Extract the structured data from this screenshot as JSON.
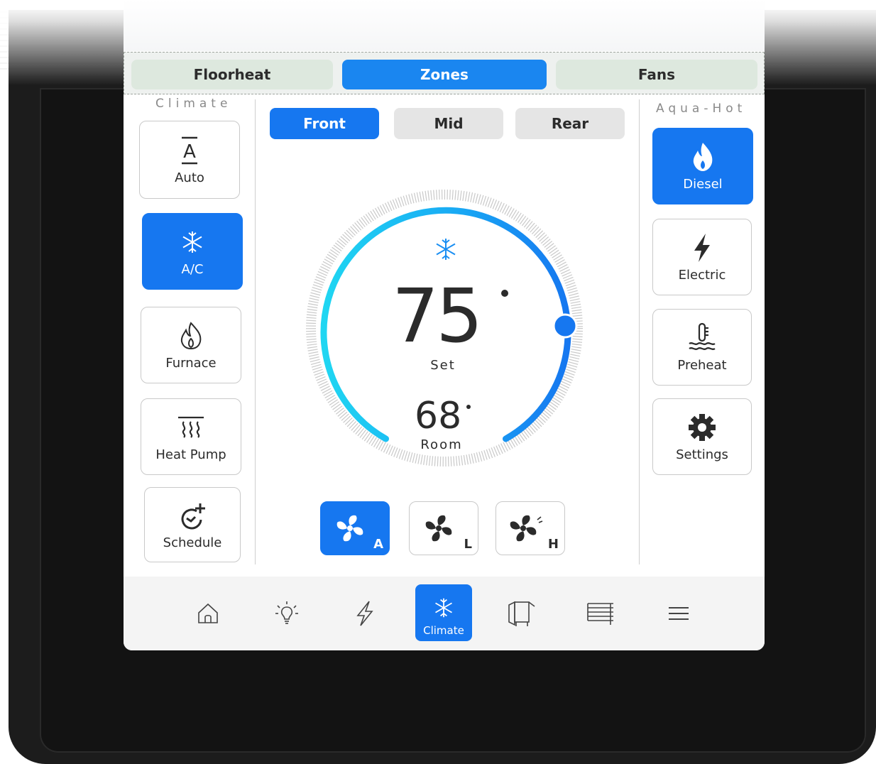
{
  "top_tabs": [
    {
      "label": "Floorheat",
      "active": false
    },
    {
      "label": "Zones",
      "active": true
    },
    {
      "label": "Fans",
      "active": false
    }
  ],
  "climate_panel": {
    "title": "Climate",
    "buttons": [
      {
        "label": "Auto",
        "icon": "auto-icon",
        "active": false
      },
      {
        "label": "A/C",
        "icon": "snowflake-icon",
        "active": true
      },
      {
        "label": "Furnace",
        "icon": "flame-icon",
        "active": false
      },
      {
        "label": "Heat Pump",
        "icon": "heat-pump-icon",
        "active": false
      },
      {
        "label": "Schedule",
        "icon": "schedule-icon",
        "active": false
      }
    ]
  },
  "zones": [
    {
      "label": "Front",
      "active": true
    },
    {
      "label": "Mid",
      "active": false
    },
    {
      "label": "Rear",
      "active": false
    }
  ],
  "thermostat": {
    "set_temp": "75",
    "set_label": "Set",
    "room_temp": "68",
    "room_label": "Room",
    "mode_icon": "snowflake-icon"
  },
  "fan_modes": [
    {
      "sub": "A",
      "active": true
    },
    {
      "sub": "L",
      "active": false
    },
    {
      "sub": "H",
      "active": false
    }
  ],
  "aquahot_panel": {
    "title": "Aqua-Hot",
    "buttons": [
      {
        "label": "Diesel",
        "icon": "flame-icon",
        "active": true
      },
      {
        "label": "Electric",
        "icon": "bolt-icon",
        "active": false
      },
      {
        "label": "Preheat",
        "icon": "water-temp-icon",
        "active": false
      },
      {
        "label": "Settings",
        "icon": "gear-icon",
        "active": false
      }
    ]
  },
  "bottom_nav": {
    "items": [
      "home-icon",
      "light-bulb-icon",
      "bolt-icon",
      "snowflake-icon",
      "slide-out-icon",
      "awning-icon",
      "menu-icon"
    ],
    "active_label": "Climate"
  },
  "colors": {
    "accent": "#1677f0",
    "tab_bg": "#dde8de",
    "gauge_start": "#1fd2f0",
    "gauge_end": "#1677f0"
  }
}
